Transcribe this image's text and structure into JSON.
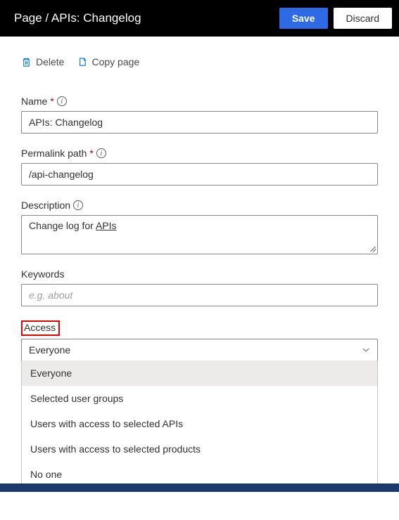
{
  "header": {
    "title": "Page / APIs: Changelog",
    "save": "Save",
    "discard": "Discard"
  },
  "toolbar": {
    "delete": "Delete",
    "copy": "Copy page"
  },
  "fields": {
    "name": {
      "label": "Name",
      "value": "APIs: Changelog"
    },
    "permalink": {
      "label": "Permalink path",
      "value": "/api-changelog"
    },
    "description": {
      "label": "Description",
      "prefix": "Change log for ",
      "underlined": "APIs"
    },
    "keywords": {
      "label": "Keywords",
      "placeholder": "e.g. about",
      "value": ""
    },
    "access": {
      "label": "Access",
      "selected": "Everyone",
      "options": [
        "Everyone",
        "Selected user groups",
        "Users with access to selected APIs",
        "Users with access to selected products",
        "No one"
      ]
    }
  }
}
